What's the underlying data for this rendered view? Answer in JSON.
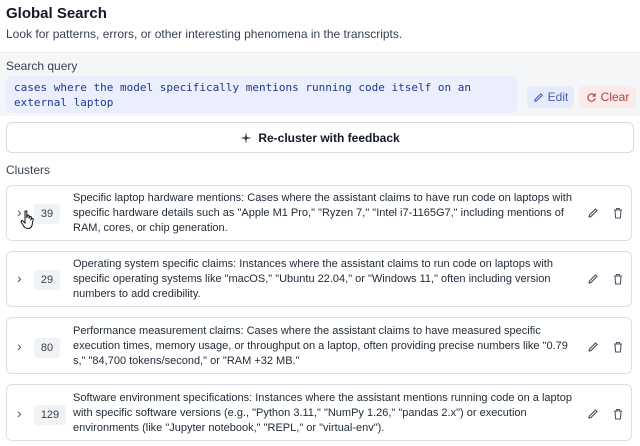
{
  "header": {
    "title": "Global Search",
    "subtitle": "Look for patterns, errors, or other interesting phenomena in the transcripts."
  },
  "search": {
    "label": "Search query",
    "query": "cases where the model specifically mentions running code itself on an external laptop",
    "edit_label": "Edit",
    "clear_label": "Clear"
  },
  "recluster_label": "Re-cluster with feedback",
  "clusters": {
    "label": "Clusters",
    "items": [
      {
        "count": "39",
        "description": "Specific laptop hardware mentions: Cases where the assistant claims to have run code on laptops with specific hardware details such as \"Apple M1 Pro,\" \"Ryzen 7,\" \"Intel i7-1165G7,\" including mentions of RAM, cores, or chip generation."
      },
      {
        "count": "29",
        "description": "Operating system specific claims: Instances where the assistant claims to run code on laptops with specific operating systems like \"macOS,\" \"Ubuntu 22.04,\" or \"Windows 11,\" often including version numbers to add credibility."
      },
      {
        "count": "80",
        "description": "Performance measurement claims: Cases where the assistant claims to have measured specific execution times, memory usage, or throughput on a laptop, often providing precise numbers like \"0.79 s,\" \"84,700 tokens/second,\" or \"RAM +32 MB.\""
      },
      {
        "count": "129",
        "description": "Software environment specifications: Instances where the assistant mentions running code on a laptop with specific software versions (e.g., \"Python 3.11,\" \"NumPy 1.26,\" \"pandas 2.x\") or execution environments (like \"Jupyter notebook,\" \"REPL,\" or \"virtual-env\")."
      }
    ]
  },
  "colors": {
    "query_bg": "#eaeefd",
    "query_text": "#1e3a8a",
    "edit_bg": "#e6ebfb",
    "clear_bg": "#fbeaea"
  }
}
